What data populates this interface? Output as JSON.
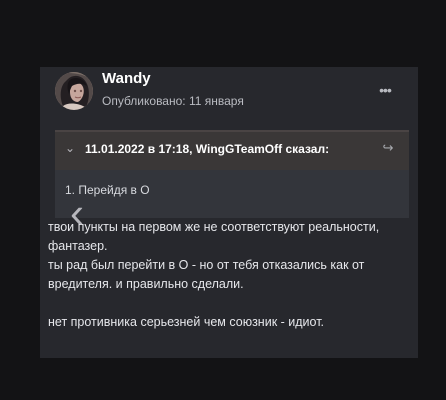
{
  "post": {
    "author": "Wandy",
    "published": "Опубликовано: 11 января",
    "more_icon": "more-icon",
    "quote": {
      "citation": "11.01.2022 в 17:18, WingGTeamOff сказал:",
      "body": "1. Перейдя в О",
      "chevron_icon": "chevron-down-icon",
      "share_icon": "share-icon"
    },
    "body_lines": [
      "твои пункты на первом же не соответствуют реальности, фантазер.",
      "ты рад был перейти в О - но от тебя отказались как от вредителя. и правильно сделали.",
      "нет противника серьезней чем союзник - идиот."
    ]
  },
  "colors": {
    "background": "#131315",
    "card": "#27282d",
    "quote_header": "#3a3737",
    "quote_body": "#33353b",
    "text": "#e6e7eb",
    "muted": "#b9bbc1"
  },
  "navigation": {
    "back_icon": "chevron-left-icon"
  }
}
